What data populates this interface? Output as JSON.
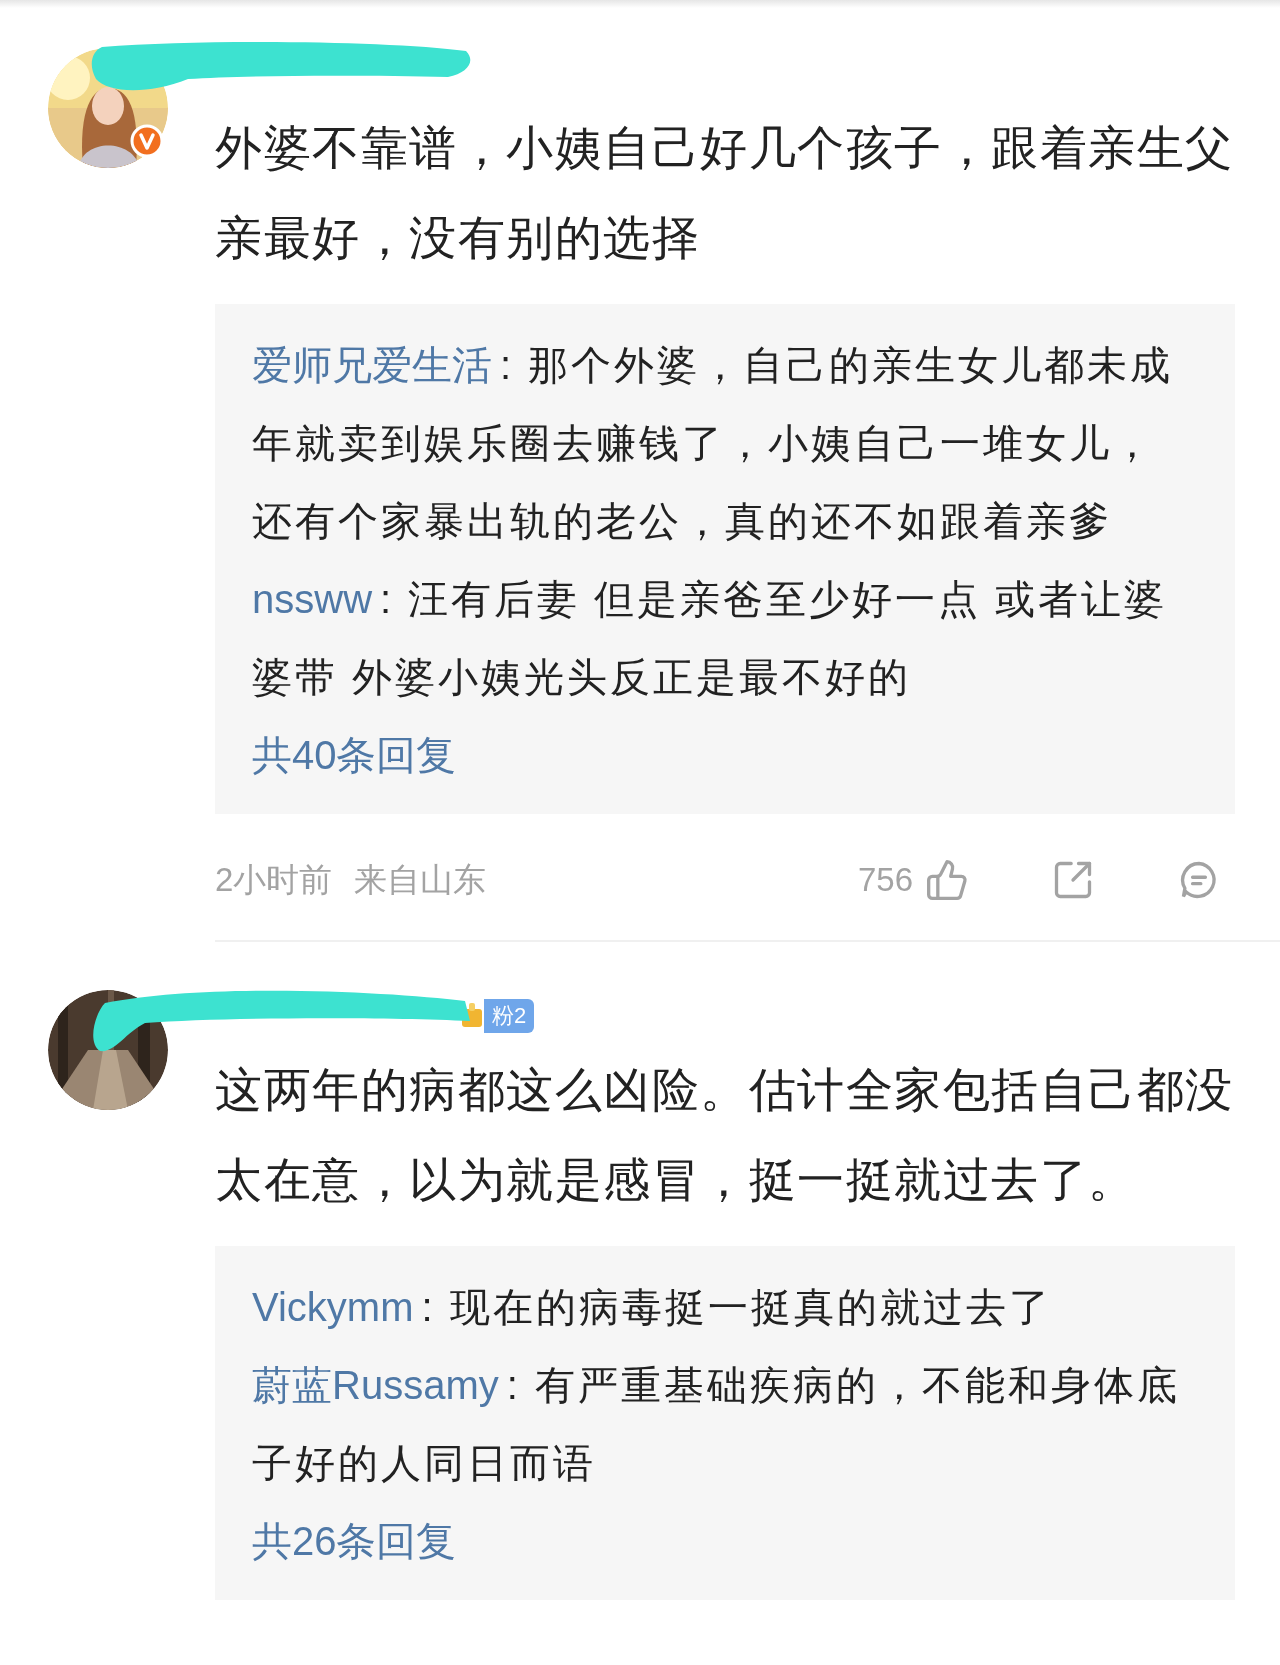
{
  "comments": [
    {
      "avatar": {
        "kind": "picture",
        "verified": true
      },
      "text": "外婆不靠谱，小姨自己好几个孩子，跟着亲生父亲最好，没有别的选择",
      "replies": [
        {
          "user": "爱师兄爱生活",
          "text": ": 那个外婆，自己的亲生女儿都未成年就卖到娱乐圈去赚钱了，小姨自己一堆女儿，还有个家暴出轨的老公，真的还不如跟着亲爹"
        },
        {
          "user": "nssww",
          "text": ": 汪有后妻 但是亲爸至少好一点 或者让婆婆带 外婆小姨光头反正是最不好的"
        }
      ],
      "more_replies": "共40条回复",
      "time": "2小时前",
      "location": "来自山东",
      "likes": "756"
    },
    {
      "avatar": {
        "kind": "picture"
      },
      "fan_badge": "粉2",
      "text": "这两年的病都这么凶险。估计全家包括自己都没太在意，以为就是感冒，挺一挺就过去了。",
      "replies": [
        {
          "user": "Vickymm",
          "text": ": 现在的病毒挺一挺真的就过去了"
        },
        {
          "user": "蔚蓝Russamy",
          "text": ": 有严重基础疾病的，不能和身体底子好的人同日而语"
        }
      ],
      "more_replies": "共26条回复"
    }
  ]
}
